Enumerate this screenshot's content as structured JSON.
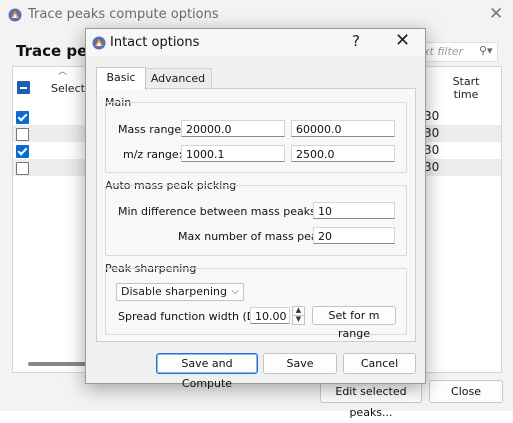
{
  "background_window": {
    "title": "Trace peaks compute options",
    "heading": "Trace peal",
    "filter_placeholder": "xt filter",
    "filter_icon": "search-dropdown-icon",
    "columns": {
      "selected": "Selecte",
      "start_time": "Start time"
    },
    "rows": [
      {
        "checked": true,
        "start": "30"
      },
      {
        "checked": false,
        "start": "30"
      },
      {
        "checked": true,
        "start": "30"
      },
      {
        "checked": false,
        "start": "30"
      }
    ],
    "buttons": {
      "edit_selected": "Edit selected peaks...",
      "close": "Close"
    }
  },
  "dialog": {
    "title": "Intact options",
    "help_label": "?",
    "close_label": "✕",
    "tabs": [
      {
        "label": "Basic",
        "active": true
      },
      {
        "label": "Advanced",
        "active": false
      }
    ],
    "main": {
      "title": "Main",
      "mass_range_label": "Mass range:",
      "mass_range_min": "20000.0",
      "mass_range_max": "60000.0",
      "mz_range_label": "m/z range:",
      "mz_range_min": "1000.1",
      "mz_range_max": "2500.0"
    },
    "auto_mass": {
      "title": "Auto mass peak picking",
      "min_diff_label": "Min difference between mass peaks (Da):",
      "min_diff_value": "10",
      "max_num_label": "Max number of mass peaks:",
      "max_num_value": "20"
    },
    "peak_sharpening": {
      "title": "Peak sharpening",
      "mode_selected": "Disable sharpening",
      "spread_label": "Spread function width (Da):",
      "spread_value": "10.00",
      "set_for_m_range_label": "Set for m range"
    },
    "buttons": {
      "save_compute": "Save and Compute",
      "save": "Save",
      "cancel": "Cancel"
    }
  },
  "colors": {
    "accent": "#0a6bd1",
    "default_button_border": "#2a6fcc"
  }
}
